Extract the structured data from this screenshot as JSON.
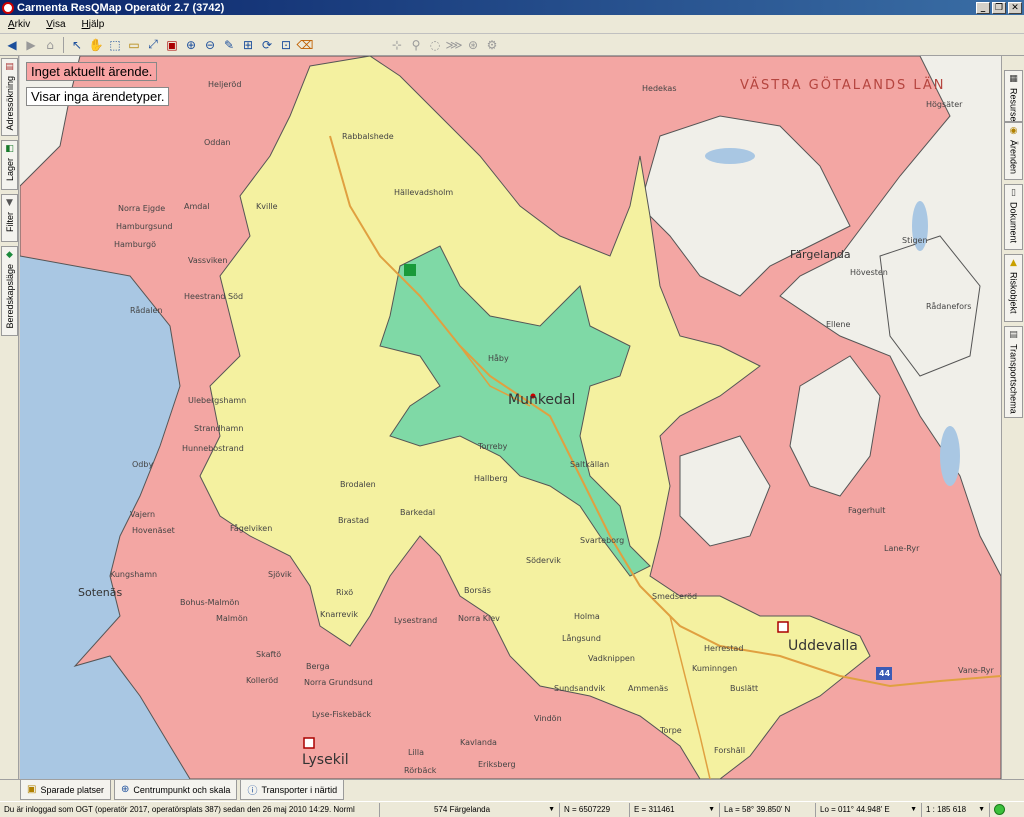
{
  "window": {
    "title": "Carmenta ResQMap Operatör 2.7 (3742)",
    "controls": [
      "_",
      "❐",
      "✕"
    ]
  },
  "menu": [
    "Arkiv",
    "Visa",
    "Hjälp"
  ],
  "left_tabs": [
    {
      "label": "Adressökning",
      "icon": "address-book-icon"
    },
    {
      "label": "Lager",
      "icon": "layers-icon"
    },
    {
      "label": "Filter",
      "icon": "funnel-icon"
    },
    {
      "label": "Beredskapsläge",
      "icon": "preparedness-icon"
    }
  ],
  "right_tabs": [
    {
      "label": "Resurser",
      "icon": "truck-icon"
    },
    {
      "label": "Ärenden",
      "icon": "case-icon"
    },
    {
      "label": "Dokument",
      "icon": "document-icon"
    },
    {
      "label": "Riskobjekt",
      "icon": "warning-icon"
    },
    {
      "label": "Transportschema",
      "icon": "schedule-icon"
    }
  ],
  "map": {
    "status_case": "Inget aktuellt ärende.",
    "status_types": "Visar inga ärendetyper.",
    "region_label": "VÄSTRA GÖTALANDS LÄN",
    "towns": {
      "munkedal": "Munkedal",
      "uddevalla": "Uddevalla",
      "lysekil": "Lysekil",
      "sotenas": "Sotenäs",
      "fargelanda": "Färgelanda"
    },
    "places": {
      "heljerod": "Heljeröd",
      "oddan": "Oddan",
      "rabbalshede": "Rabbalshede",
      "hallevadsholm": "Hällevadsholm",
      "hedekas": "Hedekas",
      "hogsater": "Högsäter",
      "norra_ejgde": "Norra Ejgde",
      "amdal": "Amdal",
      "kville": "Kville",
      "hamburgsund": "Hamburgsund",
      "hamburgo": "Hamburgö",
      "vassviken": "Vassviken",
      "heestrand": "Heestrand Söd",
      "radalen": "Rådalen",
      "stigen": "Stigen",
      "hovesten": "Hövesten",
      "radanefors": "Rådanefors",
      "ellene": "Ellene",
      "haby": "Håby",
      "torreby": "Torreby",
      "saltkallan": "Saltkällan",
      "hallberg": "Hallberg",
      "brodalen": "Brodalen",
      "barkedal": "Barkedal",
      "strandhamn": "Strandhamn",
      "hunnebostrand": "Hunnebostrand",
      "ulebergshamn": "Ulebergshamn",
      "odby": "Odby",
      "vajern": "Vajern",
      "hovenaset": "Hovenäset",
      "kungshamn": "Kungshamn",
      "fagelviken": "Fågelviken",
      "sjovik": "Sjövik",
      "bohus_malmon": "Bohus-Malmön",
      "malmon": "Malmön",
      "brastad": "Brastad",
      "rixo": "Rixö",
      "knarrevik": "Knarrevik",
      "lysestrand": "Lysestrand",
      "smogen": "Skaftö",
      "berga": "Berga",
      "norra_grundsund": "Norra Grundsund",
      "kolleröd": "Kolleröd",
      "lyse_fiskeback": "Lyse-Fiskebäck",
      "borsas": "Borsäs",
      "norra_klev": "Norra Klev",
      "holma": "Holma",
      "lanesund": "Långsund",
      "vadknippen": "Vadknippen",
      "sundsandvik": "Sundsandvik",
      "vindon": "Vindön",
      "herrestad": "Herrestad",
      "ammenas": "Ammenäs",
      "kuminngen": "Kuminngen",
      "buslatt": "Buslätt",
      "fagerhult": "Fagerhult",
      "lane_ryr": "Lane-Ryr",
      "vane_ryr": "Vane-Ryr",
      "smedserod": "Smedseröd",
      "sodervik": "Södervik",
      "kavlanda": "Kavlanda",
      "lilla": "Lilla",
      "rorback": "Rörbäck",
      "eriksberg": "Eriksberg",
      "torpe": "Torpe",
      "forshal": "Forshäll",
      "svarteborg": "Svarteborg"
    },
    "road_shield": "44",
    "colors": {
      "red_zone": "#f3a6a3",
      "yellow_zone": "#f4f1a0",
      "green_zone": "#7fd9a6",
      "water": "#a9c7e3",
      "land": "#f0efe9"
    }
  },
  "bottom_tabs": [
    {
      "label": "Sparade platser",
      "icon": "saved-places-icon"
    },
    {
      "label": "Centrumpunkt och skala",
      "icon": "center-point-icon"
    },
    {
      "label": "Transporter i närtid",
      "icon": "info-icon"
    }
  ],
  "status": {
    "login": "Du är inloggad som OGT (operatör 2017, operatörsplats 387) sedan den 26 maj 2010 14:29. Norml",
    "area": "574 Färgelanda",
    "north": "N = 6507229",
    "east": "E = 311461",
    "lat": "La = 58° 39.850' N",
    "lon": "Lo = 011° 44.948' E",
    "scale": "1 : 185 618"
  }
}
